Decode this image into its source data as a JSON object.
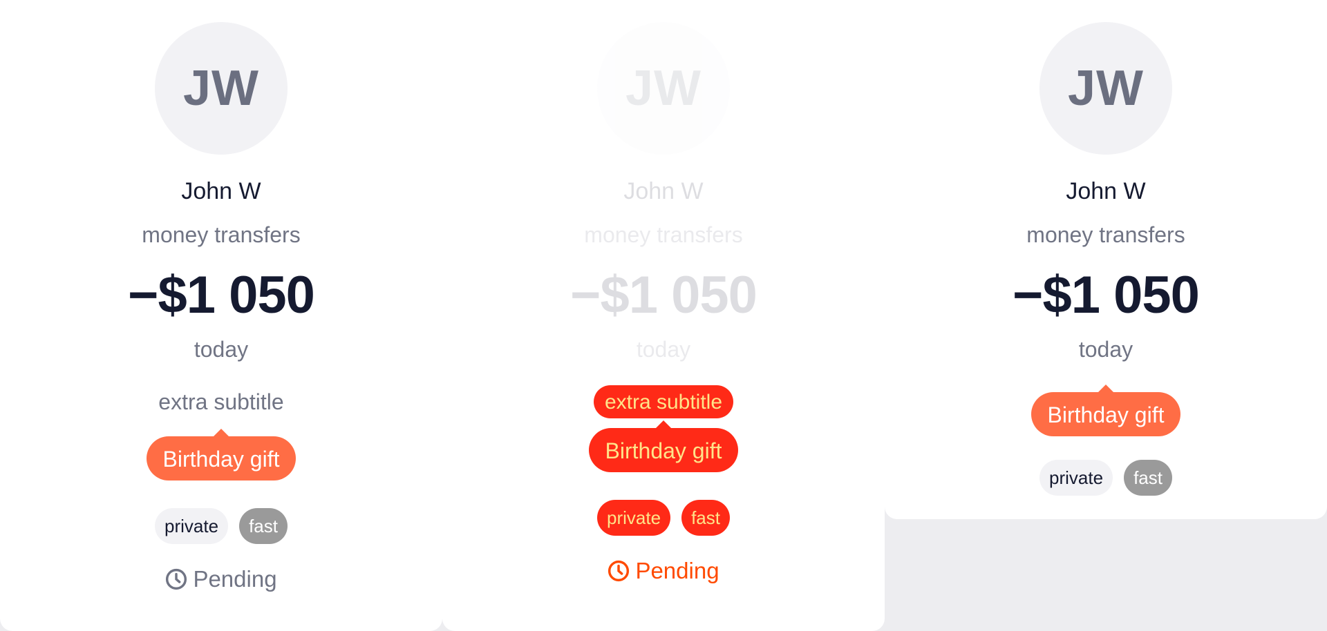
{
  "cards": [
    {
      "avatar_initials": "JW",
      "name": "John W",
      "category": "money transfers",
      "amount": "−$1 050",
      "date": "today",
      "extra_subtitle": "extra subtitle",
      "tag_label": "Birthday gift",
      "tags": [
        "private",
        "fast"
      ],
      "status": "Pending"
    },
    {
      "avatar_initials": "JW",
      "name": "John W",
      "category": "money transfers",
      "amount": "−$1 050",
      "date": "today",
      "extra_subtitle": "extra subtitle",
      "tag_label": "Birthday gift",
      "tags": [
        "private",
        "fast"
      ],
      "status": "Pending"
    },
    {
      "avatar_initials": "JW",
      "name": "John W",
      "category": "money transfers",
      "amount": "−$1 050",
      "date": "today",
      "tag_label": "Birthday gift",
      "tags": [
        "private",
        "fast"
      ]
    }
  ],
  "colors": {
    "accent": "#ff6d45",
    "text_primary": "#151a30",
    "text_secondary": "#707484",
    "tag_fast_bg": "#9a9a9a",
    "highlight_red": "#ff2a17",
    "highlight_yellow": "#ffe48a"
  },
  "icons": {
    "status": "clock-icon"
  }
}
